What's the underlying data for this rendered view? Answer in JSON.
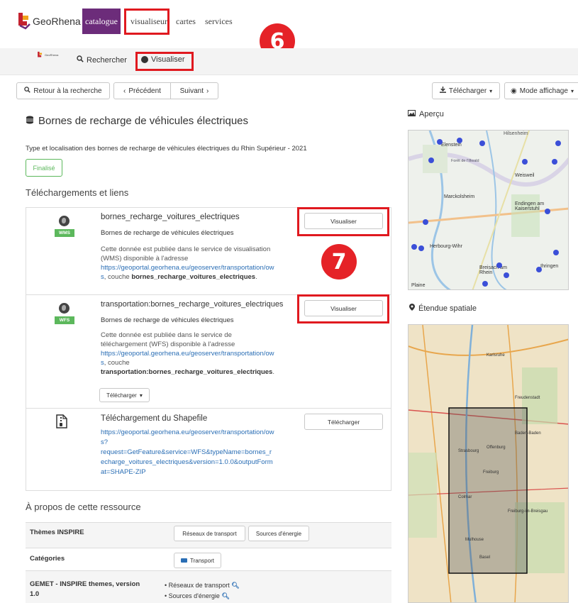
{
  "header": {
    "logo_text": "GeoRhena",
    "nav": {
      "catalogue": "catalogue",
      "visualiseur": "visualiseur",
      "cartes": "cartes",
      "services": "services"
    },
    "badge_6": "6"
  },
  "subnav": {
    "logo_small": "GeoRhena",
    "rechercher": "Rechercher",
    "visualiser": "Visualiser"
  },
  "toolbar": {
    "retour": "Retour à la recherche",
    "precedent": "Précédent",
    "suivant": "Suivant",
    "telecharger": "Télécharger",
    "mode_affichage": "Mode affichage"
  },
  "record": {
    "title": "Bornes de recharge de véhicules électriques",
    "description": "Type et localisation des bornes de recharge de véhicules électriques du Rhin Supérieur - 2021",
    "status": "Finalisé"
  },
  "links_section": {
    "heading": "Téléchargements et liens",
    "badge_7": "7",
    "items": [
      {
        "icon": "globe-icon",
        "tag": "WMS",
        "title": "bornes_recharge_voitures_electriques",
        "subtitle": "Bornes de recharge de véhicules électriques",
        "text_1": "Cette donnée est publiée dans le service de visualisation",
        "text_2": "(WMS) disponible à l'adresse",
        "url_1": "https://geoportal.georhena.eu/geoserver/transportation/ow",
        "text_3_link": "s",
        "text_3": ", couche ",
        "layer": "bornes_recharge_voitures_electriques",
        "text_4": ".",
        "button": "Visualiser"
      },
      {
        "icon": "globe-icon",
        "tag": "WFS",
        "title": "transportation:bornes_recharge_voitures_electriques",
        "subtitle": "Bornes de recharge de véhicules électriques",
        "text_1": "Cette donnée est publiée dans le service de",
        "text_2": "téléchargement (WFS) disponible à l'adresse",
        "url_1": "https://geoportal.georhena.eu/geoserver/transportation/ow",
        "text_3_link": "s",
        "text_3": ", couche",
        "layer": "transportation:bornes_recharge_voitures_electriques",
        "text_4": ".",
        "button": "Visualiser",
        "dropdown": "Télécharger"
      },
      {
        "icon": "file-zip-icon",
        "title": "Téléchargement du Shapefile",
        "url_lines": [
          "https://geoportal.georhena.eu/geoserver/transportation/ow",
          "s?",
          "request=GetFeature&service=WFS&typeName=bornes_r",
          "echarge_voitures_electriques&version=1.0.0&outputForm",
          "at=SHAPE-ZIP"
        ],
        "button": "Télécharger"
      }
    ]
  },
  "about": {
    "heading": "À propos de cette ressource",
    "rows": [
      {
        "label": "Thèmes INSPIRE",
        "values": [
          "Réseaux de transport",
          "Sources d'énergie"
        ]
      },
      {
        "label": "Catégories",
        "values": [
          "Transport"
        ]
      },
      {
        "label_1": "GEMET - INSPIRE themes, version",
        "label_2": "1.0",
        "values": [
          "Réseaux de transport",
          "Sources d'énergie"
        ]
      }
    ]
  },
  "side": {
    "apercu": "Aperçu",
    "etendue": "Étendue spatiale",
    "map1_labels": [
      "Hilsenheim",
      "Elenstein",
      "Forêt de l'Illwald",
      "Weisweil",
      "Marckolsheim",
      "Endingen am Kaiserstuhl",
      "Herbourg-Wihr",
      "Breisach am Rhein",
      "Ihringen",
      "Plaine"
    ],
    "map2_labels": [
      "Karlsruhe",
      "Baden-Baden",
      "Offenburg",
      "Freiburg",
      "Strasbourg",
      "Colmar",
      "Mulhouse",
      "Basel",
      "Freudenstadt",
      "Freiburg-im-Breisgau"
    ]
  },
  "colors": {
    "brand": "#6c2c7a",
    "annotation_red": "#e0191f",
    "status_green": "#5cb85c",
    "link": "#2a6eb5"
  }
}
